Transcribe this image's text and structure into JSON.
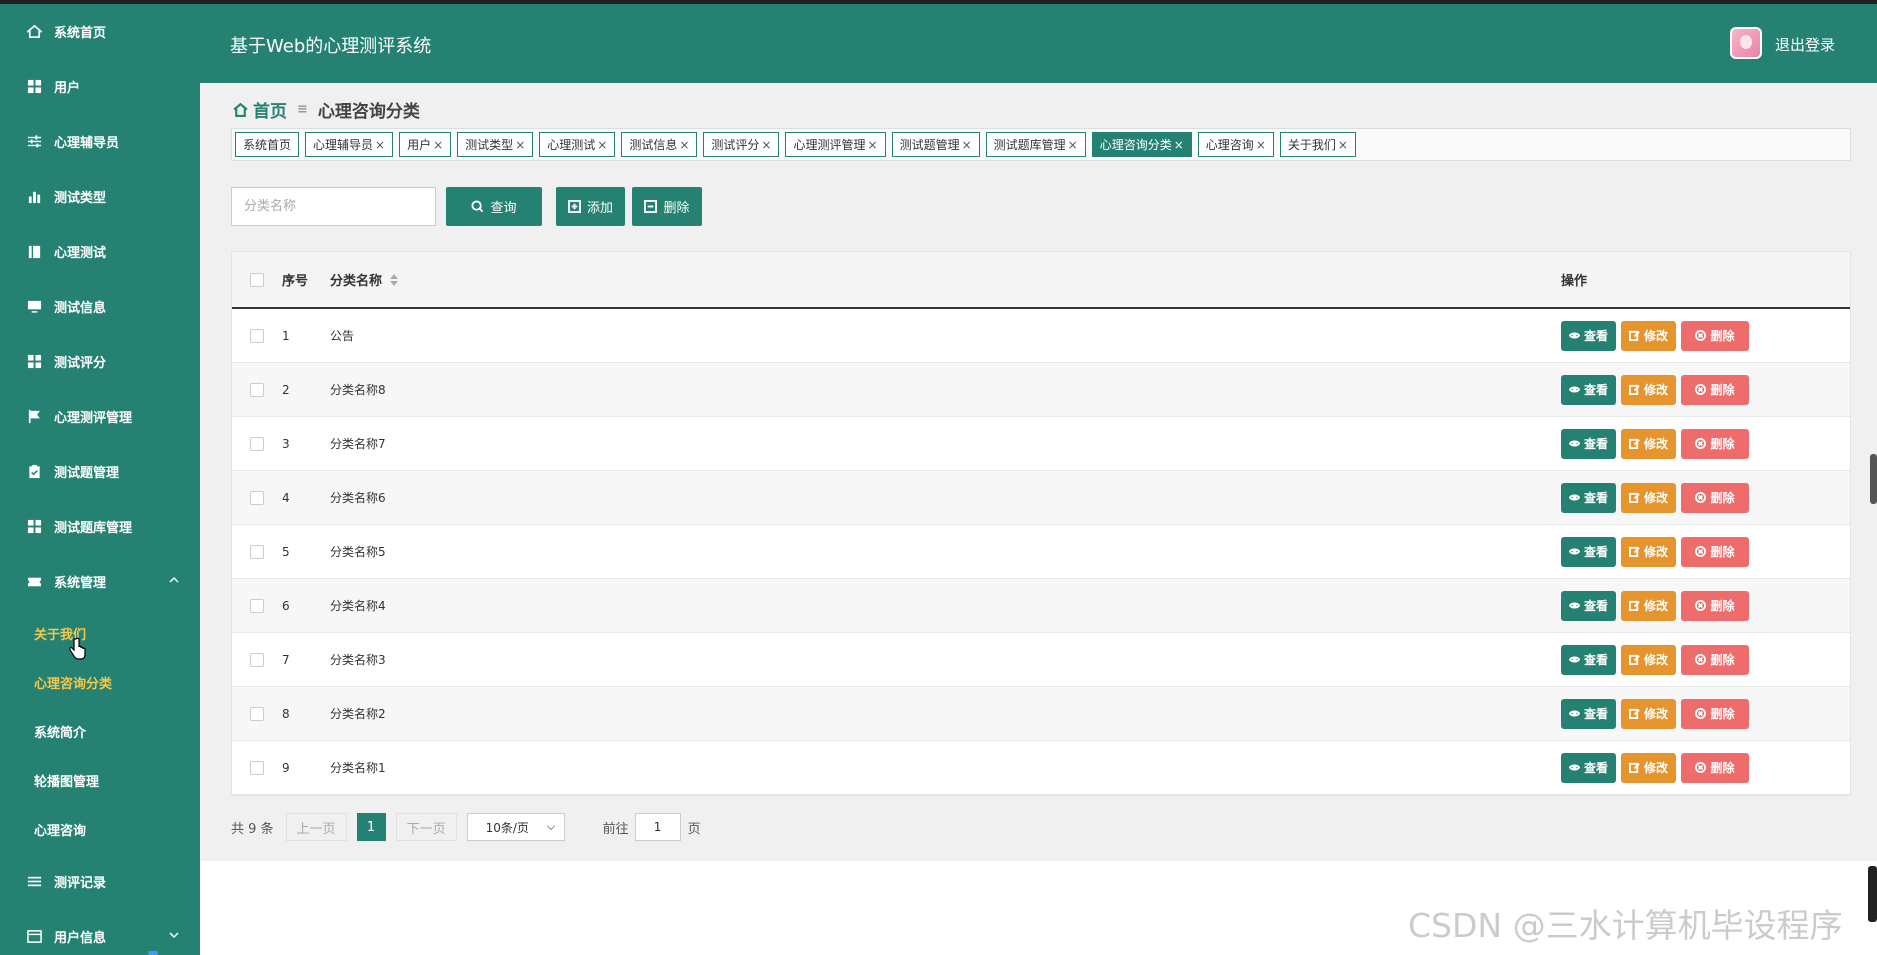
{
  "app": {
    "title": "基于Web的心理测评系统",
    "logout_label": "退出登录"
  },
  "sidebar": {
    "items": [
      {
        "label": "系统首页",
        "icon": "home-icon"
      },
      {
        "label": "用户",
        "icon": "grid-icon"
      },
      {
        "label": "心理辅导员",
        "icon": "sliders-icon"
      },
      {
        "label": "测试类型",
        "icon": "bar-chart-icon"
      },
      {
        "label": "心理测试",
        "icon": "book-icon"
      },
      {
        "label": "测试信息",
        "icon": "monitor-icon"
      },
      {
        "label": "测试评分",
        "icon": "grid-icon"
      },
      {
        "label": "心理测评管理",
        "icon": "flag-icon"
      },
      {
        "label": "测试题管理",
        "icon": "clipboard-icon"
      },
      {
        "label": "测试题库管理",
        "icon": "grid-icon"
      }
    ],
    "group": {
      "label": "系统管理",
      "icon": "ticket-icon"
    },
    "subitems": [
      {
        "label": "关于我们",
        "active": true
      },
      {
        "label": "心理咨询分类",
        "active": true
      },
      {
        "label": "系统简介",
        "active": false
      },
      {
        "label": "轮播图管理",
        "active": false
      },
      {
        "label": "心理咨询",
        "active": false
      }
    ],
    "bottom_items": [
      {
        "label": "测评记录",
        "icon": "list-icon"
      },
      {
        "label": "用户信息",
        "icon": "card-icon"
      }
    ]
  },
  "breadcrumb": {
    "home": "首页",
    "current": "心理咨询分类"
  },
  "tags": [
    {
      "label": "系统首页",
      "closable": false,
      "active": false
    },
    {
      "label": "心理辅导员",
      "closable": true,
      "active": false
    },
    {
      "label": "用户",
      "closable": true,
      "active": false
    },
    {
      "label": "测试类型",
      "closable": true,
      "active": false
    },
    {
      "label": "心理测试",
      "closable": true,
      "active": false
    },
    {
      "label": "测试信息",
      "closable": true,
      "active": false
    },
    {
      "label": "测试评分",
      "closable": true,
      "active": false
    },
    {
      "label": "心理测评管理",
      "closable": true,
      "active": false
    },
    {
      "label": "测试题管理",
      "closable": true,
      "active": false
    },
    {
      "label": "测试题库管理",
      "closable": true,
      "active": false
    },
    {
      "label": "心理咨询分类",
      "closable": true,
      "active": true
    },
    {
      "label": "心理咨询",
      "closable": true,
      "active": false
    },
    {
      "label": "关于我们",
      "closable": true,
      "active": false
    }
  ],
  "search": {
    "placeholder": "分类名称",
    "search_label": "查询",
    "add_label": "添加",
    "delete_label": "删除"
  },
  "table": {
    "headers": {
      "index": "序号",
      "name": "分类名称",
      "ops": "操作"
    },
    "rows": [
      {
        "index": "1",
        "name": "公告"
      },
      {
        "index": "2",
        "name": "分类名称8"
      },
      {
        "index": "3",
        "name": "分类名称7"
      },
      {
        "index": "4",
        "name": "分类名称6"
      },
      {
        "index": "5",
        "name": "分类名称5"
      },
      {
        "index": "6",
        "name": "分类名称4"
      },
      {
        "index": "7",
        "name": "分类名称3"
      },
      {
        "index": "8",
        "name": "分类名称2"
      },
      {
        "index": "9",
        "name": "分类名称1"
      }
    ],
    "row_actions": {
      "view": "查看",
      "edit": "修改",
      "delete": "删除"
    }
  },
  "pager": {
    "total": "共 9 条",
    "prev": "上一页",
    "page": "1",
    "next": "下一页",
    "size": "10条/页",
    "goto_prefix": "前往",
    "goto_value": "1",
    "goto_suffix": "页"
  },
  "watermark": "CSDN @三水计算机毕设程序",
  "colors": {
    "brand": "#258272",
    "edit": "#e6942e",
    "delete": "#ee6c6c",
    "active_sub": "#f5c74a"
  }
}
